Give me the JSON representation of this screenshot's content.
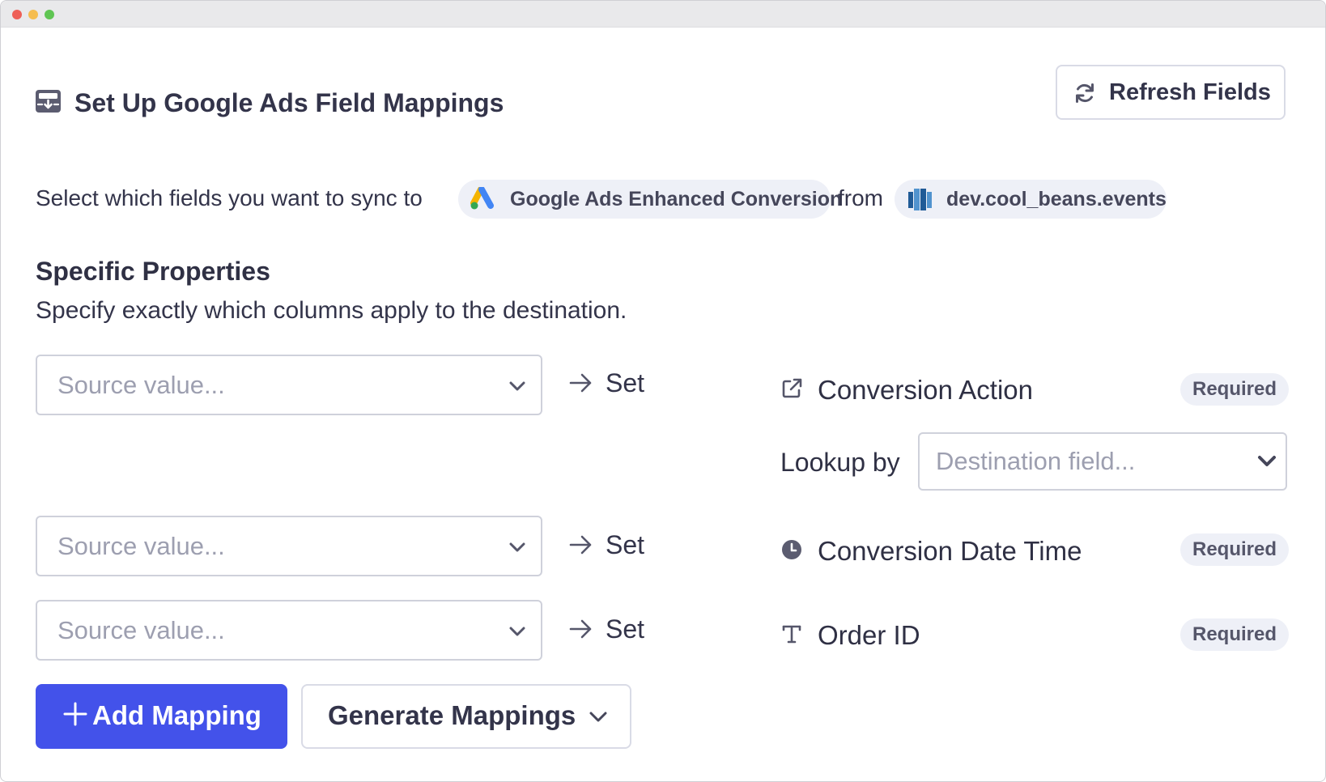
{
  "header": {
    "title": "Set Up Google Ads Field Mappings",
    "icon": "inbox-download-icon",
    "refresh_label": "Refresh Fields"
  },
  "sync": {
    "prefix": "Select which fields you want to sync to",
    "destination": "Google Ads Enhanced Conversion",
    "connector": "from",
    "source": "dev.cool_beans.events"
  },
  "section": {
    "title": "Specific Properties",
    "subtitle": "Specify exactly which columns apply to the destination."
  },
  "mappings": [
    {
      "source_placeholder": "Source value...",
      "set_label": "Set",
      "field_name": "Conversion Action",
      "field_icon": "external-link-icon",
      "badge": "Required",
      "lookup_label": "Lookup by",
      "lookup_placeholder": "Destination field..."
    },
    {
      "source_placeholder": "Source value...",
      "set_label": "Set",
      "field_name": "Conversion Date Time",
      "field_icon": "clock-icon",
      "badge": "Required"
    },
    {
      "source_placeholder": "Source value...",
      "set_label": "Set",
      "field_name": "Order ID",
      "field_icon": "text-type-icon",
      "badge": "Required"
    }
  ],
  "actions": {
    "add_label": "Add Mapping",
    "generate_label": "Generate Mappings"
  },
  "colors": {
    "primary": "#4352ea",
    "pill_bg": "#eef0f7",
    "text": "#33344a",
    "placeholder": "#9d9fb0"
  }
}
